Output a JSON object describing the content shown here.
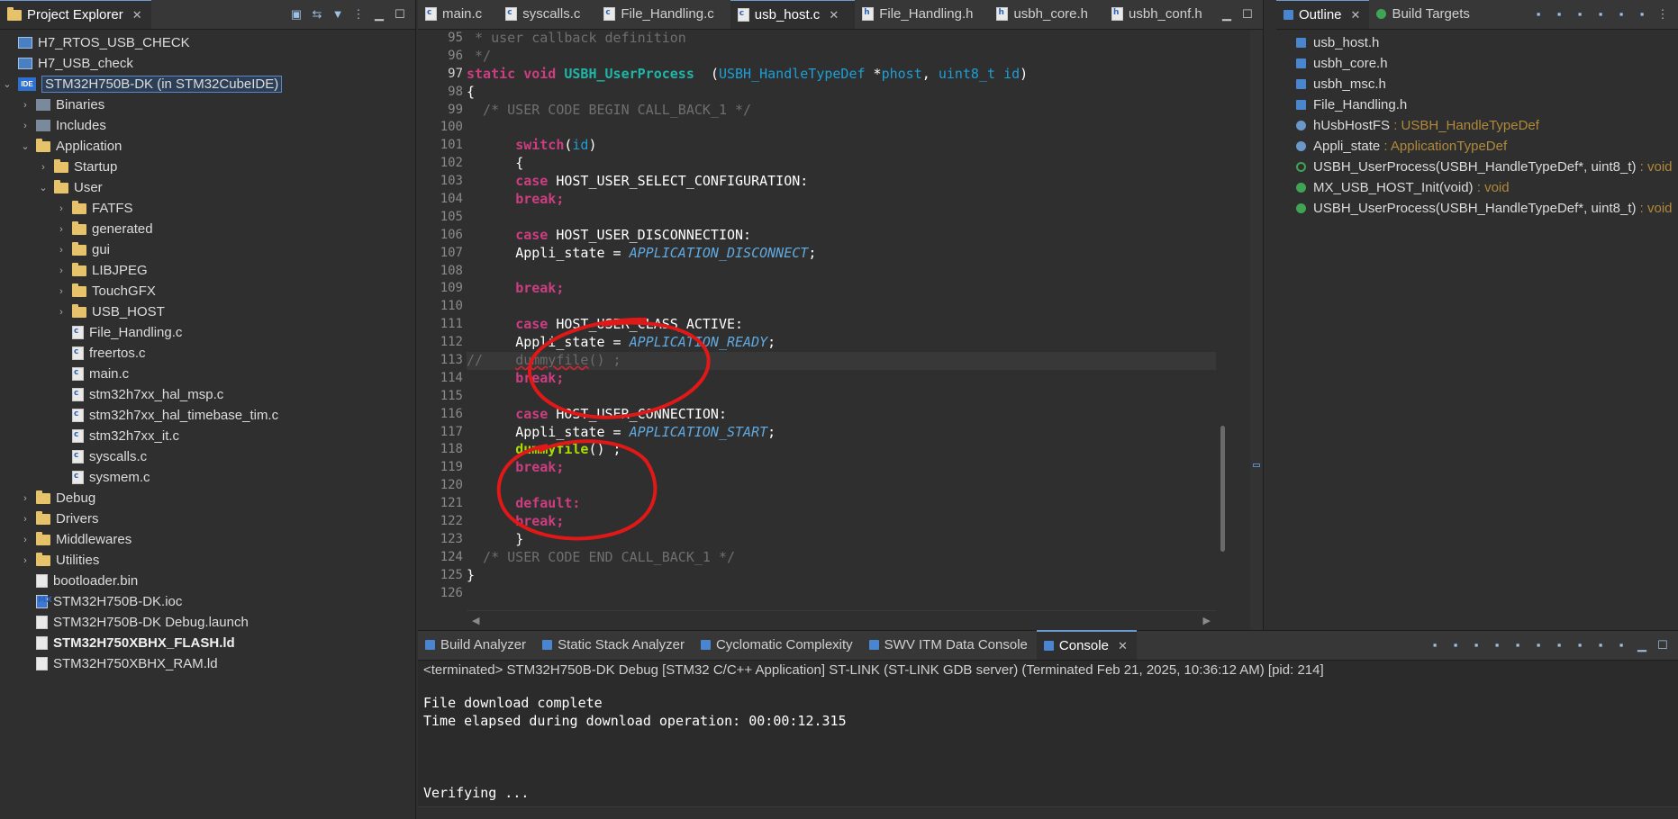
{
  "colors": {
    "annotation": "#e01818",
    "keyword": "#cc3e80",
    "function": "#1fb6a8",
    "type": "#1d9fd6",
    "constant": "#5fa9e0",
    "comment": "#6f6f6f"
  },
  "explorer": {
    "tab_label": "Project Explorer",
    "toolbar_icons": [
      "collapse-all-icon",
      "link-editor-icon",
      "filter-icon",
      "view-menu-icon",
      "minimize-icon",
      "maximize-icon"
    ],
    "items": [
      {
        "label": "H7_RTOS_USB_CHECK",
        "icon": "project-icon",
        "depth": 0
      },
      {
        "label": "H7_USB_check",
        "icon": "project-icon",
        "depth": 0
      },
      {
        "label": "STM32H750B-DK (in STM32CubeIDE)",
        "icon": "ide-project-icon",
        "depth": 0
      },
      {
        "label": "Binaries",
        "icon": "binaries-icon",
        "depth": 1
      },
      {
        "label": "Includes",
        "icon": "includes-icon",
        "depth": 1
      },
      {
        "label": "Application",
        "icon": "folder-icon",
        "depth": 1
      },
      {
        "label": "Startup",
        "icon": "folder-icon",
        "depth": 2
      },
      {
        "label": "User",
        "icon": "folder-icon",
        "depth": 2
      },
      {
        "label": "FATFS",
        "icon": "folder-icon",
        "depth": 3
      },
      {
        "label": "generated",
        "icon": "folder-icon",
        "depth": 3
      },
      {
        "label": "gui",
        "icon": "folder-icon",
        "depth": 3
      },
      {
        "label": "LIBJPEG",
        "icon": "folder-icon",
        "depth": 3
      },
      {
        "label": "TouchGFX",
        "icon": "folder-icon",
        "depth": 3
      },
      {
        "label": "USB_HOST",
        "icon": "folder-icon",
        "depth": 3
      },
      {
        "label": "File_Handling.c",
        "icon": "c-file-icon",
        "depth": 3
      },
      {
        "label": "freertos.c",
        "icon": "c-file-icon",
        "depth": 3
      },
      {
        "label": "main.c",
        "icon": "c-file-icon",
        "depth": 3
      },
      {
        "label": "stm32h7xx_hal_msp.c",
        "icon": "c-file-icon",
        "depth": 3
      },
      {
        "label": "stm32h7xx_hal_timebase_tim.c",
        "icon": "c-file-icon",
        "depth": 3
      },
      {
        "label": "stm32h7xx_it.c",
        "icon": "c-file-icon",
        "depth": 3
      },
      {
        "label": "syscalls.c",
        "icon": "c-file-icon",
        "depth": 3
      },
      {
        "label": "sysmem.c",
        "icon": "c-file-icon",
        "depth": 3
      },
      {
        "label": "Debug",
        "icon": "folder-icon",
        "depth": 1
      },
      {
        "label": "Drivers",
        "icon": "folder-icon",
        "depth": 1
      },
      {
        "label": "Middlewares",
        "icon": "folder-icon",
        "depth": 1
      },
      {
        "label": "Utilities",
        "icon": "folder-icon",
        "depth": 1
      },
      {
        "label": "bootloader.bin",
        "icon": "file-icon",
        "depth": 1
      },
      {
        "label": "STM32H750B-DK.ioc",
        "icon": "mx-file-icon",
        "depth": 1
      },
      {
        "label": "STM32H750B-DK Debug.launch",
        "icon": "file-icon",
        "depth": 1
      },
      {
        "label": "STM32H750XBHX_FLASH.ld",
        "icon": "file-icon",
        "depth": 1
      },
      {
        "label": "STM32H750XBHX_RAM.ld",
        "icon": "file-icon",
        "depth": 1
      }
    ]
  },
  "editor": {
    "tabs": [
      {
        "label": "main.c",
        "active": false
      },
      {
        "label": "syscalls.c",
        "active": false
      },
      {
        "label": "File_Handling.c",
        "active": false
      },
      {
        "label": "usb_host.c",
        "active": true
      },
      {
        "label": "File_Handling.h",
        "active": false
      },
      {
        "label": "usbh_core.h",
        "active": false
      },
      {
        "label": "usbh_conf.h",
        "active": false
      }
    ],
    "line_numbers": [
      "95",
      "96",
      "97",
      "98",
      "99",
      "100",
      "101",
      "102",
      "103",
      "104",
      "105",
      "106",
      "107",
      "108",
      "109",
      "110",
      "111",
      "112",
      "113",
      "114",
      "115",
      "116",
      "117",
      "118",
      "119",
      "120",
      "121",
      "122",
      "123",
      "124",
      "125",
      "126"
    ],
    "code": {
      "l95": " * user callback definition",
      "l96": " */",
      "l97_kw": "static void",
      "l97_fn": "USBH_UserProcess",
      "l97_p1": "(",
      "l97_t1": "USBH_HandleTypeDef",
      "l97_p2": " *",
      "l97_a1": "phost",
      "l97_p3": ", ",
      "l97_t2": "uint8_t",
      "l97_a2": "id",
      "l97_p4": ")",
      "l98": "{",
      "l99": "  /* USER CODE BEGIN CALL_BACK_1 */",
      "l101_kw": "switch",
      "l101_p1": "(",
      "l101_a": "id",
      "l101_p2": ")",
      "l102": "{",
      "case": "case",
      "break": "break;",
      "default": "default:",
      "l103": " HOST_USER_SELECT_CONFIGURATION:",
      "l106": " HOST_USER_DISCONNECTION:",
      "appli": "Appli_state = ",
      "l107_c": "APPLICATION_DISCONNECT",
      "semi": ";",
      "l111": " HOST_USER_CLASS_ACTIVE:",
      "l112_c": "APPLICATION_READY",
      "l113_slash": "//",
      "l113_fn": "dummyfile",
      "l113_rest": "() ;",
      "l116": " HOST_USER_CONNECTION:",
      "l117_c": "APPLICATION_START",
      "l118_fn": "dummyfile",
      "l118_rest": "() ;",
      "l123": "}",
      "l124": "  /* USER CODE END CALL_BACK_1 */",
      "l125": "}"
    }
  },
  "outline": {
    "tabs": [
      {
        "label": "Outline",
        "active": true
      },
      {
        "label": "Build Targets",
        "active": false
      }
    ],
    "items": [
      {
        "label": "usb_host.h",
        "type": "",
        "icon": "include-icon"
      },
      {
        "label": "usbh_core.h",
        "type": "",
        "icon": "include-icon"
      },
      {
        "label": "usbh_msc.h",
        "type": "",
        "icon": "include-icon"
      },
      {
        "label": "File_Handling.h",
        "type": "",
        "icon": "include-icon"
      },
      {
        "label": "hUsbHostFS",
        "type": " : USBH_HandleTypeDef",
        "icon": "variable-icon"
      },
      {
        "label": "Appli_state",
        "type": " : ApplicationTypeDef",
        "icon": "variable-icon"
      },
      {
        "label": "USBH_UserProcess(USBH_HandleTypeDef*, uint8_t)",
        "type": " : void",
        "icon": "function-prototype-icon"
      },
      {
        "label": "MX_USB_HOST_Init(void)",
        "type": " : void",
        "icon": "function-icon"
      },
      {
        "label": "USBH_UserProcess(USBH_HandleTypeDef*, uint8_t)",
        "type": " : void",
        "icon": "function-icon"
      }
    ]
  },
  "bottom": {
    "tabs": [
      {
        "label": "Build Analyzer",
        "active": false
      },
      {
        "label": "Static Stack Analyzer",
        "active": false
      },
      {
        "label": "Cyclomatic Complexity",
        "active": false
      },
      {
        "label": "SWV ITM Data Console",
        "active": false
      },
      {
        "label": "Console",
        "active": true
      }
    ],
    "status": "<terminated> STM32H750B-DK Debug [STM32 C/C++ Application] ST-LINK (ST-LINK GDB server) (Terminated Feb 21, 2025, 10:36:12 AM) [pid: 214]",
    "console_lines": [
      "File download complete",
      "Time elapsed during download operation: 00:00:12.315",
      "",
      "",
      "",
      "Verifying ..."
    ]
  }
}
